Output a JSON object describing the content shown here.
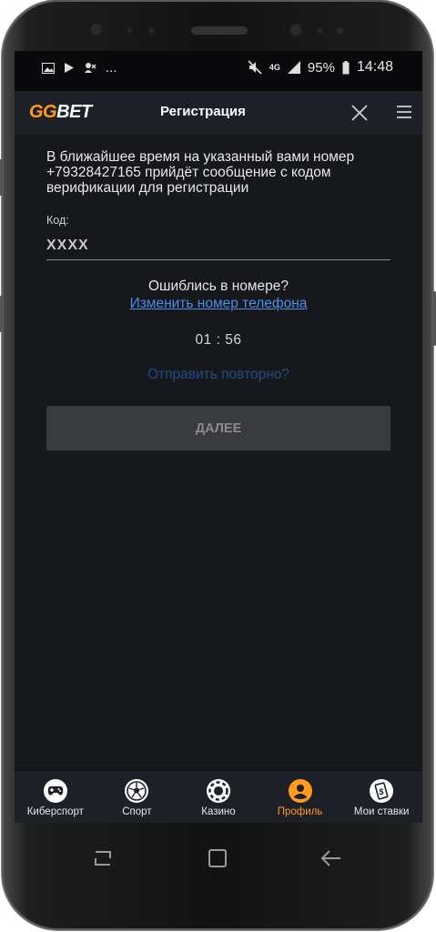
{
  "status_bar": {
    "dots": "...",
    "network": "4G",
    "battery": "95%",
    "time": "14:48"
  },
  "header": {
    "logo_gg": "GG",
    "logo_bet": "BET",
    "title": "Регистрация"
  },
  "form": {
    "info_text": "В ближайшее время на указанный вами номер +79328427165 прийдёт сообщение с кодом верификации для регистрации",
    "code_label": "Код:",
    "code_placeholder": "XXXX",
    "mistake_text": "Ошиблись в номере?",
    "change_link": "Изменить номер телефона",
    "timer": "01 : 56",
    "resend": "Отправить повторно?",
    "next_button": "ДАЛЕЕ"
  },
  "bottom_nav": {
    "items": [
      {
        "label": "Киберспорт",
        "icon": "gamepad-icon"
      },
      {
        "label": "Спорт",
        "icon": "soccer-ball-icon"
      },
      {
        "label": "Казино",
        "icon": "casino-chip-icon"
      },
      {
        "label": "Профиль",
        "icon": "profile-icon"
      },
      {
        "label": "Мои ставки",
        "icon": "bets-ticket-icon"
      }
    ],
    "active_index": 3
  },
  "colors": {
    "accent": "#ff9a1f",
    "link": "#4a8fe8",
    "resend": "#1f4e86",
    "background": "#17181c",
    "appbar": "#1e2027"
  }
}
